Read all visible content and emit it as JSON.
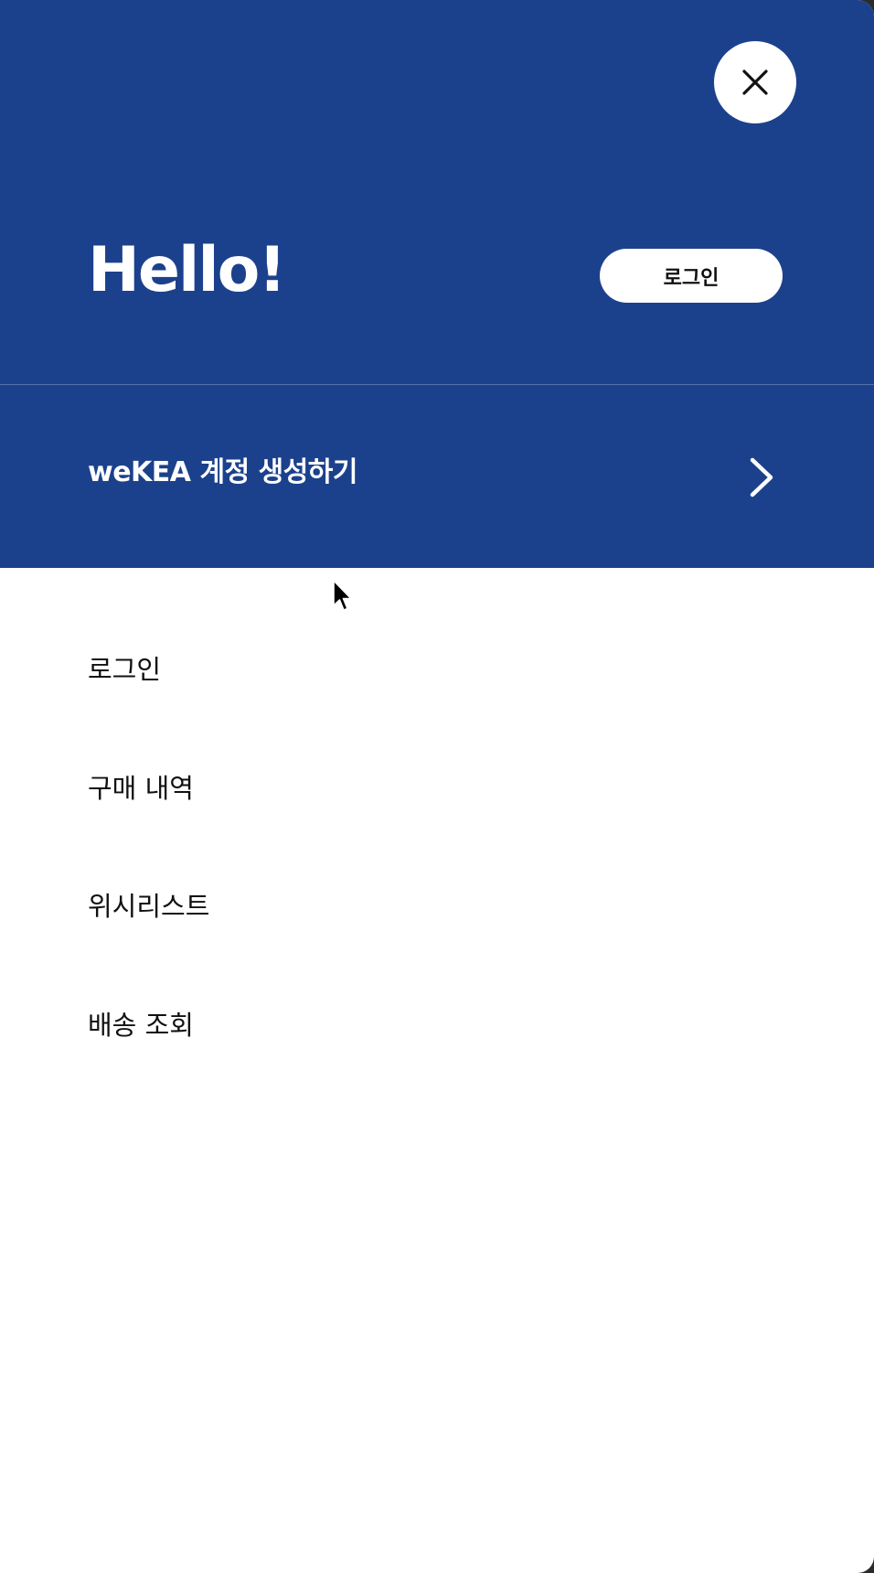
{
  "header": {
    "greeting": "Hello!",
    "login_button_label": "로그인",
    "create_account_label": "weKEA 계정 생성하기"
  },
  "menu": {
    "items": [
      {
        "label": "로그인"
      },
      {
        "label": "구매 내역"
      },
      {
        "label": "위시리스트"
      },
      {
        "label": "배송 조회"
      }
    ]
  },
  "icons": {
    "close": "close-icon",
    "chevron": "chevron-right-icon",
    "cursor": "mouse-pointer-icon"
  },
  "colors": {
    "header_background": "#1c418c",
    "panel_background": "#ffffff",
    "text_dark": "#111111",
    "text_light": "#ffffff"
  }
}
